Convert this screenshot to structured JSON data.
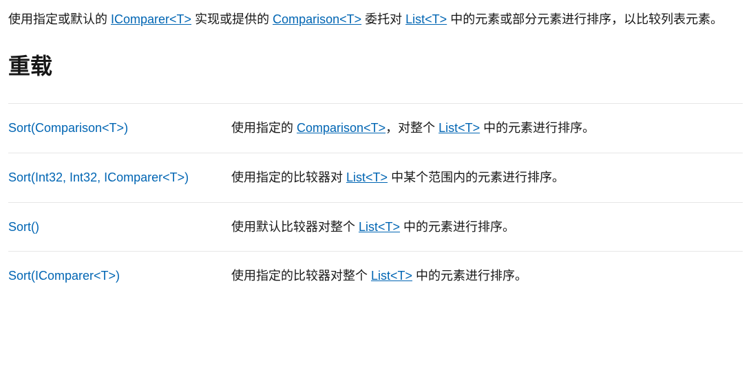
{
  "intro": {
    "parts": [
      {
        "type": "text",
        "text": "使用指定或默认的 "
      },
      {
        "type": "link",
        "text": "IComparer<T>"
      },
      {
        "type": "text",
        "text": " 实现或提供的 "
      },
      {
        "type": "link",
        "text": "Comparison<T>"
      },
      {
        "type": "text",
        "text": " 委托对 "
      },
      {
        "type": "link",
        "text": "List<T>"
      },
      {
        "type": "text",
        "text": " 中的元素或部分元素进行排序，以比较列表元素。"
      }
    ]
  },
  "heading": "重载",
  "overloads": [
    {
      "name": "Sort(Comparison<T>)",
      "desc_parts": [
        {
          "type": "text",
          "text": "使用指定的 "
        },
        {
          "type": "link",
          "text": "Comparison<T>"
        },
        {
          "type": "text",
          "text": "，对整个 "
        },
        {
          "type": "link",
          "text": "List<T>"
        },
        {
          "type": "text",
          "text": " 中的元素进行排序。"
        }
      ]
    },
    {
      "name": "Sort(Int32, Int32, IComparer<T>)",
      "desc_parts": [
        {
          "type": "text",
          "text": "使用指定的比较器对 "
        },
        {
          "type": "link",
          "text": "List<T>"
        },
        {
          "type": "text",
          "text": " 中某个范围内的元素进行排序。"
        }
      ]
    },
    {
      "name": "Sort()",
      "desc_parts": [
        {
          "type": "text",
          "text": "使用默认比较器对整个 "
        },
        {
          "type": "link",
          "text": "List<T>"
        },
        {
          "type": "text",
          "text": " 中的元素进行排序。"
        }
      ]
    },
    {
      "name": "Sort(IComparer<T>)",
      "desc_parts": [
        {
          "type": "text",
          "text": "使用指定的比较器对整个 "
        },
        {
          "type": "link",
          "text": "List<T>"
        },
        {
          "type": "text",
          "text": " 中的元素进行排序。"
        }
      ]
    }
  ]
}
